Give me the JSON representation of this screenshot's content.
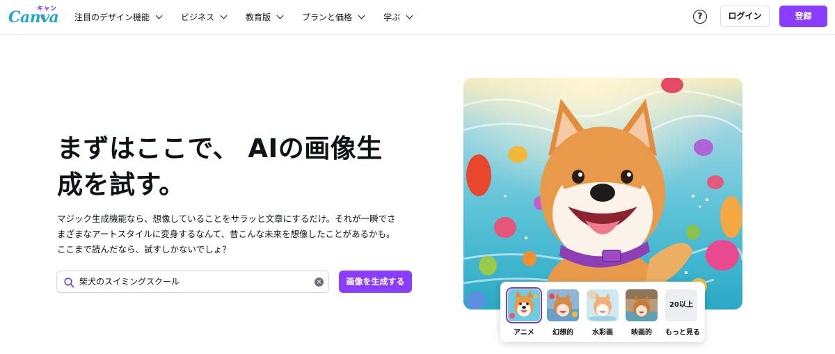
{
  "header": {
    "logo_small": "キャンバ",
    "logo_main": "Canva",
    "nav": [
      {
        "label": "注目のデザイン機能"
      },
      {
        "label": "ビジネス"
      },
      {
        "label": "教育版"
      },
      {
        "label": "プランと価格"
      },
      {
        "label": "学ぶ"
      }
    ],
    "help_label": "?",
    "login_label": "ログイン",
    "signup_label": "登録"
  },
  "hero": {
    "headline_line1": "まずはここで、 AIの画像生",
    "headline_line2": "成を試す。",
    "description_lines": [
      "マジック生成機能なら、想像していることをサラッと文章にするだけ。それが一瞬でさ",
      "まざまなアートスタイルに変身するなんて、昔こんな未来を想像したことがあるかも。",
      "ここまで読んだなら、試すしかないでしょ？"
    ],
    "search": {
      "value": "柴犬のスイミングスクール",
      "clear_icon": "×"
    },
    "generate_label": "画像を生成する"
  },
  "styles": {
    "items": [
      {
        "label": "アニメ",
        "selected": true
      },
      {
        "label": "幻想的",
        "selected": false
      },
      {
        "label": "水彩画",
        "selected": false
      },
      {
        "label": "映画的",
        "selected": false
      }
    ],
    "more_count": "20以上",
    "more_label": "もっと見る"
  },
  "colors": {
    "brand_purple": "#8b3dff",
    "logo_teal": "#1ea9c9"
  }
}
